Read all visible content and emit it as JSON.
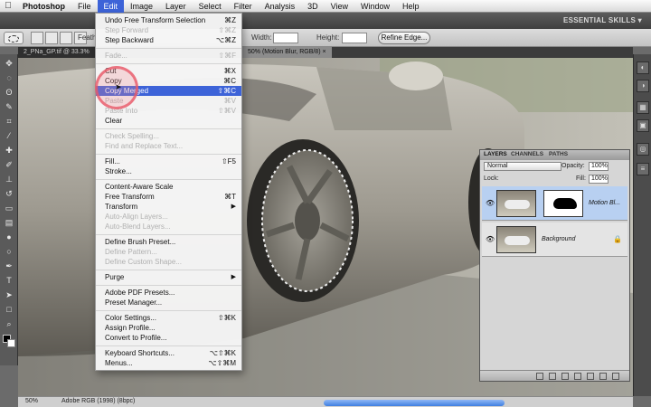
{
  "menubar": {
    "apple": "",
    "items": [
      "Photoshop",
      "File",
      "Edit",
      "Image",
      "Layer",
      "Select",
      "Filter",
      "Analysis",
      "3D",
      "View",
      "Window",
      "Help"
    ]
  },
  "appbar": {
    "workspace": "ESSENTIAL SKILLS ▾"
  },
  "options": {
    "feather_label": "Feath",
    "width_label": "Width:",
    "height_label": "Height:",
    "refine_edge": "Refine Edge..."
  },
  "document": {
    "tabs": [
      "2_PNa_GP.tif @ 33.3%",
      "50% (Motion Blur, RGB/8) ×"
    ],
    "zoom": "50%",
    "profile": "Adobe RGB (1998) (8bpc)"
  },
  "edit_menu": {
    "items": [
      {
        "label": "Undo Free Transform Selection",
        "shortcut": "⌘Z",
        "disabled": false
      },
      {
        "label": "Step Forward",
        "shortcut": "⇧⌘Z",
        "disabled": true
      },
      {
        "label": "Step Backward",
        "shortcut": "⌥⌘Z",
        "disabled": false
      },
      {
        "label": "Fade...",
        "shortcut": "⇧⌘F",
        "disabled": true
      },
      {
        "label": "Cut",
        "shortcut": "⌘X",
        "disabled": false
      },
      {
        "label": "Copy",
        "shortcut": "⌘C",
        "disabled": false
      },
      {
        "label": "Copy Merged",
        "shortcut": "⇧⌘C",
        "disabled": false,
        "highlighted": true
      },
      {
        "label": "Paste",
        "shortcut": "⌘V",
        "disabled": true
      },
      {
        "label": "Paste Into",
        "shortcut": "⇧⌘V",
        "disabled": true
      },
      {
        "label": "Clear",
        "shortcut": "",
        "disabled": false
      },
      {
        "label": "Check Spelling...",
        "shortcut": "",
        "disabled": true
      },
      {
        "label": "Find and Replace Text...",
        "shortcut": "",
        "disabled": true
      },
      {
        "label": "Fill...",
        "shortcut": "⇧F5",
        "disabled": false
      },
      {
        "label": "Stroke...",
        "shortcut": "",
        "disabled": false
      },
      {
        "label": "Content-Aware Scale",
        "shortcut": "",
        "disabled": false
      },
      {
        "label": "Free Transform",
        "shortcut": "⌘T",
        "disabled": false
      },
      {
        "label": "Transform",
        "shortcut": "",
        "disabled": false,
        "submenu": true
      },
      {
        "label": "Auto-Align Layers...",
        "shortcut": "",
        "disabled": true
      },
      {
        "label": "Auto-Blend Layers...",
        "shortcut": "",
        "disabled": true
      },
      {
        "label": "Define Brush Preset...",
        "shortcut": "",
        "disabled": false
      },
      {
        "label": "Define Pattern...",
        "shortcut": "",
        "disabled": true
      },
      {
        "label": "Define Custom Shape...",
        "shortcut": "",
        "disabled": true
      },
      {
        "label": "Purge",
        "shortcut": "",
        "disabled": false,
        "submenu": true
      },
      {
        "label": "Adobe PDF Presets...",
        "shortcut": "",
        "disabled": false
      },
      {
        "label": "Preset Manager...",
        "shortcut": "",
        "disabled": false
      },
      {
        "label": "Color Settings...",
        "shortcut": "⇧⌘K",
        "disabled": false
      },
      {
        "label": "Assign Profile...",
        "shortcut": "",
        "disabled": false
      },
      {
        "label": "Convert to Profile...",
        "shortcut": "",
        "disabled": false
      },
      {
        "label": "Keyboard Shortcuts...",
        "shortcut": "⌥⇧⌘K",
        "disabled": false
      },
      {
        "label": "Menus...",
        "shortcut": "⌥⇧⌘M",
        "disabled": false
      }
    ]
  },
  "layers_panel": {
    "tabs": [
      "LAYERS",
      "CHANNELS",
      "PATHS"
    ],
    "blend_mode": "Normal",
    "opacity_label": "Opacity:",
    "opacity": "100%",
    "lock_label": "Lock:",
    "fill_label": "Fill:",
    "fill": "100%",
    "layers": [
      {
        "name": "Motion Bl...",
        "selected": true
      },
      {
        "name": "Background",
        "selected": false
      }
    ]
  },
  "colors": {
    "accent": "#3d63d8",
    "highlight_circle": "#e85a69"
  }
}
